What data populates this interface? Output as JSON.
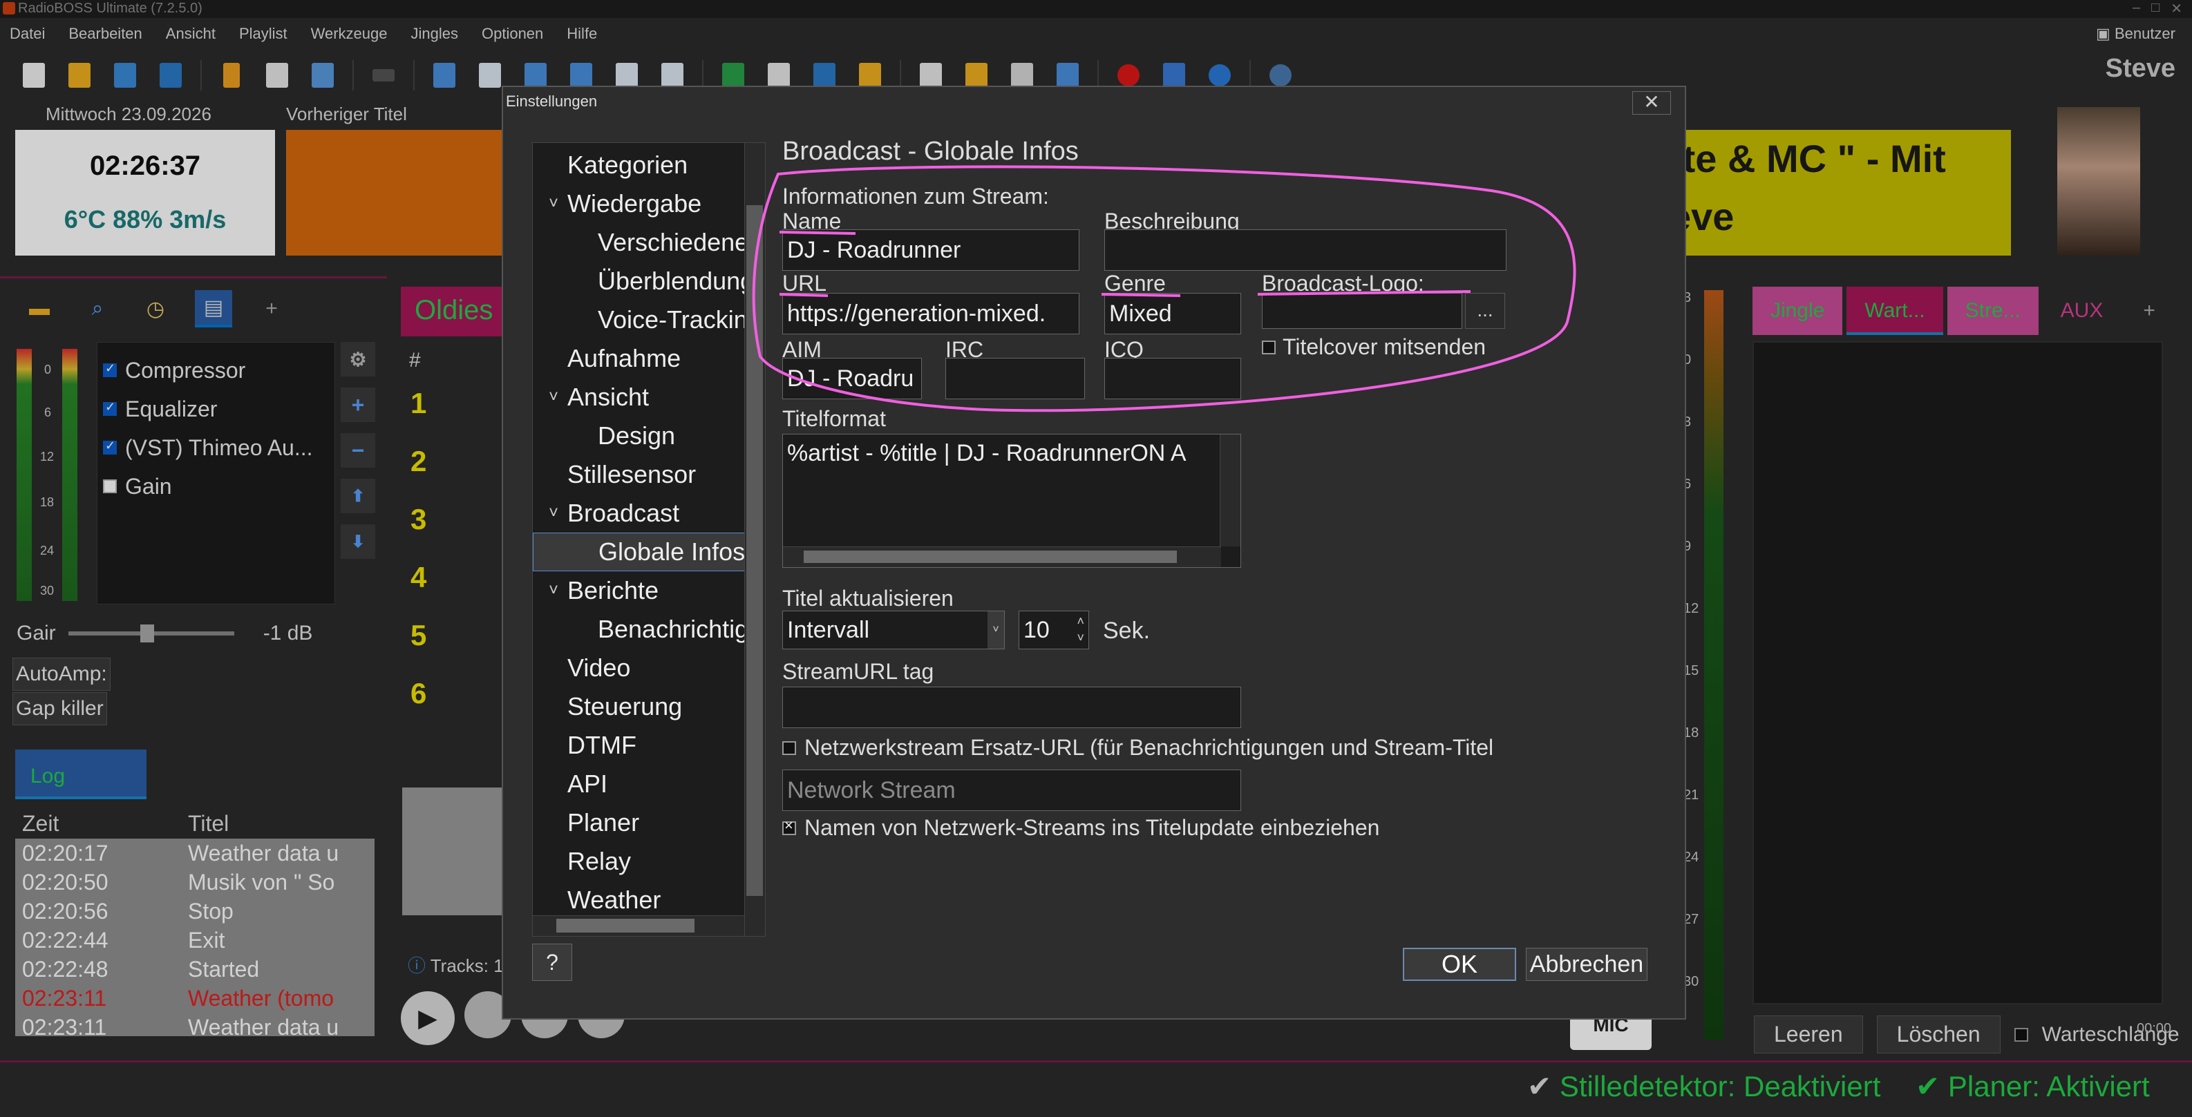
{
  "window": {
    "title": "RadioBOSS Ultimate (7.2.5.0)",
    "user_label": "Benutzer",
    "user_name": "Steve"
  },
  "menu": [
    "Datei",
    "Bearbeiten",
    "Ansicht",
    "Playlist",
    "Werkzeuge",
    "Jingles",
    "Optionen",
    "Hilfe"
  ],
  "header": {
    "date": "Mittwoch 23.09.2026",
    "time": "02:26:37",
    "weather": "6°C 88% 3m/s",
    "prev_label": "Vorheriger Titel",
    "now_line1": "tte & MC \" - Mit",
    "now_line2": "eve"
  },
  "left": {
    "effects": [
      {
        "label": "Compressor",
        "checked": true
      },
      {
        "label": "Equalizer",
        "checked": true
      },
      {
        "label": "(VST) Thimeo Au...",
        "checked": true
      },
      {
        "label": "Gain",
        "checked": false
      }
    ],
    "meter_scale": [
      "0",
      "6",
      "12",
      "18",
      "24",
      "30"
    ],
    "gain_label": "Gair",
    "gain_value": "-1 dB",
    "autoamp": "AutoAmp:",
    "gapkiller": "Gap killer",
    "log_tab": "Log",
    "log_headers": {
      "time": "Zeit",
      "title": "Titel"
    },
    "log_rows": [
      {
        "time": "02:20:17",
        "title": "Weather data u"
      },
      {
        "time": "02:20:50",
        "title": "Musik von \" So"
      },
      {
        "time": "02:20:56",
        "title": "Stop"
      },
      {
        "time": "02:22:44",
        "title": "Exit"
      },
      {
        "time": "02:22:48",
        "title": "Started"
      },
      {
        "time": "02:23:11",
        "title": "Weather (tomo"
      },
      {
        "time": "02:23:11",
        "title": "Weather data u"
      }
    ]
  },
  "playlist": {
    "tab": "Oldies",
    "hash": "#",
    "numbers": [
      "1",
      "2",
      "3",
      "4",
      "5",
      "6"
    ],
    "tracks": "Tracks: 1"
  },
  "right": {
    "tabs": [
      "Jingle",
      "Wart...",
      "Stre...",
      "AUX",
      "+"
    ],
    "tab_colors": [
      "#c84c98",
      "#a8175a",
      "#c84c98",
      "#2b2b2b"
    ],
    "clear": "Leeren",
    "delete": "Löschen",
    "queue_label": "Warteschlange",
    "time": "00:00",
    "scale": [
      "3",
      "0",
      "3",
      "6",
      "9",
      "12",
      "15",
      "18",
      "21",
      "24",
      "27",
      "30"
    ]
  },
  "mic": "MIC",
  "status": {
    "silence": "Stilledetektor: Deaktiviert",
    "scheduler": "Planer: Aktiviert"
  },
  "dialog": {
    "title": "Einstellungen",
    "tree": [
      {
        "label": "Kategorien",
        "level": 0,
        "chev": ""
      },
      {
        "label": "Wiedergabe",
        "level": 0,
        "chev": "˅"
      },
      {
        "label": "Verschiedenes",
        "level": 1,
        "chev": ""
      },
      {
        "label": "Überblendungen",
        "level": 1,
        "chev": ""
      },
      {
        "label": "Voice-Tracking",
        "level": 1,
        "chev": ""
      },
      {
        "label": "Aufnahme",
        "level": 0,
        "chev": ""
      },
      {
        "label": "Ansicht",
        "level": 0,
        "chev": "˅"
      },
      {
        "label": "Design",
        "level": 1,
        "chev": ""
      },
      {
        "label": "Stillesensor",
        "level": 0,
        "chev": ""
      },
      {
        "label": "Broadcast",
        "level": 0,
        "chev": "˅"
      },
      {
        "label": "Globale Infos",
        "level": 1,
        "chev": "",
        "selected": true
      },
      {
        "label": "Berichte",
        "level": 0,
        "chev": "˅"
      },
      {
        "label": "Benachrichtigungen",
        "level": 1,
        "chev": ""
      },
      {
        "label": "Video",
        "level": 0,
        "chev": ""
      },
      {
        "label": "Steuerung",
        "level": 0,
        "chev": ""
      },
      {
        "label": "DTMF",
        "level": 0,
        "chev": ""
      },
      {
        "label": "API",
        "level": 0,
        "chev": ""
      },
      {
        "label": "Planer",
        "level": 0,
        "chev": ""
      },
      {
        "label": "Relay",
        "level": 0,
        "chev": ""
      },
      {
        "label": "Weather",
        "level": 0,
        "chev": ""
      }
    ],
    "panel_title": "Broadcast - Globale Infos",
    "stream_info": "Informationen zum Stream:",
    "name_label": "Name",
    "name_value": "DJ - Roadrunner",
    "desc_label": "Beschreibung",
    "desc_value": "",
    "url_label": "URL",
    "url_value": "https://generation-mixed.",
    "genre_label": "Genre",
    "genre_value": "Mixed",
    "logo_label": "Broadcast-Logo:",
    "logo_button": "...",
    "titlecover_label": "Titelcover mitsenden",
    "aim_label": "AIM",
    "aim_value": "DJ - Roadru",
    "irc_label": "IRC",
    "irc_value": "",
    "icq_label": "ICQ",
    "icq_value": "",
    "titleformat_label": "Titelformat",
    "titleformat_value": "%artist - %title | DJ - RoadrunnerON A",
    "update_label": "Titel aktualisieren",
    "update_mode": "Intervall",
    "update_interval": "10",
    "update_unit": "Sek.",
    "streamurl_label": "StreamURL tag",
    "streamurl_value": "",
    "fallback_label": "Netzwerkstream Ersatz-URL (für Benachrichtigungen und Stream-Titel",
    "fallback_placeholder": "Network Stream",
    "netnames_label": "Namen von Netzwerk-Streams ins Titelupdate einbeziehen",
    "ok": "OK",
    "cancel": "Abbrechen",
    "help": "?",
    "annotation_color": "#f060e0"
  }
}
